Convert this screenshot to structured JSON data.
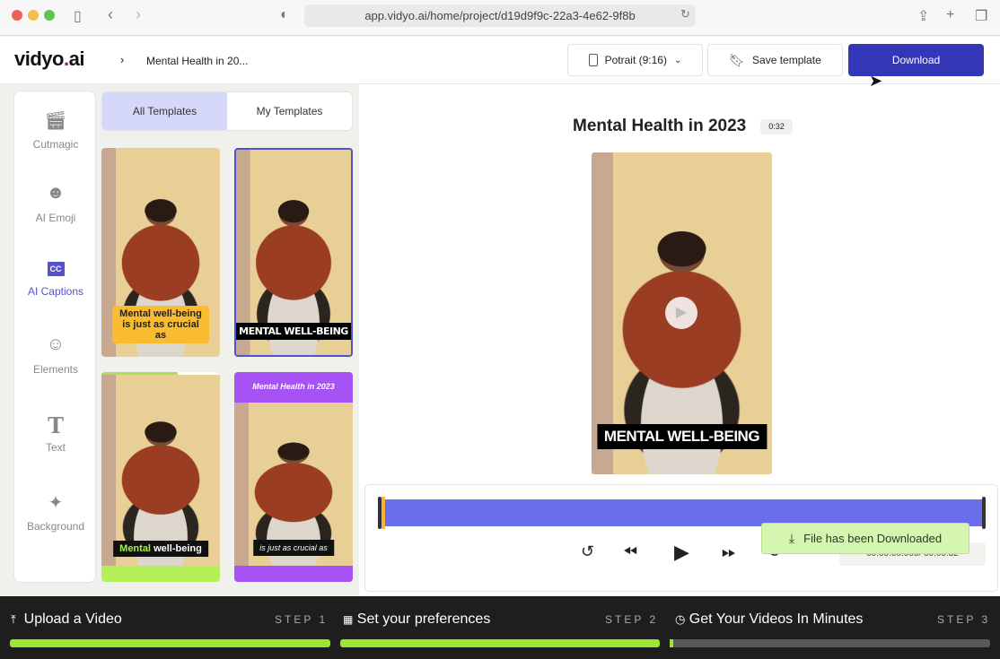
{
  "browser": {
    "url": "app.vidyo.ai/home/project/d19d9f9c-22a3-4e62-9f8b"
  },
  "header": {
    "logo": "vidyo",
    "logo_dot": ".",
    "logo_suffix": "ai",
    "breadcrumb_sep": "›",
    "breadcrumb": "Mental Health in 20...",
    "aspect": "Potrait (9:16)",
    "save_template": "Save template",
    "download": "Download"
  },
  "sidebar": {
    "items": [
      {
        "label": "Cutmagic",
        "icon": "clapper-sparkle-icon"
      },
      {
        "label": "AI Emoji",
        "icon": "emoji-icon"
      },
      {
        "label": "AI Captions",
        "icon": "cc-icon",
        "active": true
      },
      {
        "label": "Elements",
        "icon": "smiley-icon"
      },
      {
        "label": "Text",
        "icon": "text-icon"
      },
      {
        "label": "Background",
        "icon": "sparkle-icon"
      }
    ]
  },
  "templates": {
    "tabs": [
      "All Templates",
      "My Templates"
    ],
    "items": [
      {
        "caption": "Mental well-being is just as crucial as"
      },
      {
        "caption": "MENTAL WELL-BEING"
      },
      {
        "caption_highlight": "Mental",
        "caption": "well-being"
      },
      {
        "header": "Mental Health in 2023",
        "caption": "is just as crucial as"
      }
    ]
  },
  "preview": {
    "title": "Mental Health in 2023",
    "duration": "0:32",
    "caption": "MENTAL WELL-BEING"
  },
  "timeline": {
    "time": "00:00:00.000/ 00:00:32",
    "toast": "File has been Downloaded",
    "accent": "#6a6ee9"
  },
  "steps": [
    {
      "label": "Upload a Video",
      "step": "STEP 1",
      "progress": 1
    },
    {
      "label": "Set your preferences",
      "step": "STEP 2",
      "progress": 1
    },
    {
      "label": "Get Your Videos In Minutes",
      "step": "STEP 3",
      "progress": 0.01
    }
  ]
}
